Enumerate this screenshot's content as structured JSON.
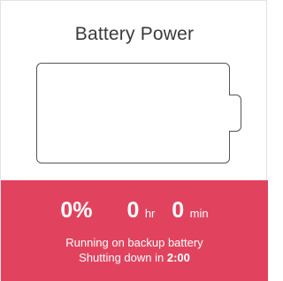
{
  "card": {
    "title": "Battery Power"
  },
  "battery": {
    "charge_fraction": 0.0
  },
  "stats": {
    "percent": "0%",
    "hours": "0",
    "hours_unit": "hr",
    "minutes": "0",
    "minutes_unit": "min"
  },
  "status": {
    "line1": "Running on backup battery",
    "line2_prefix": "Shutting down in ",
    "countdown": "2:00"
  },
  "colors": {
    "accent": "#e1435e",
    "outline": "#555555",
    "text_dark": "#3a3a3a",
    "panel_text": "#ffffff"
  },
  "icons": {
    "battery": "battery-icon"
  }
}
